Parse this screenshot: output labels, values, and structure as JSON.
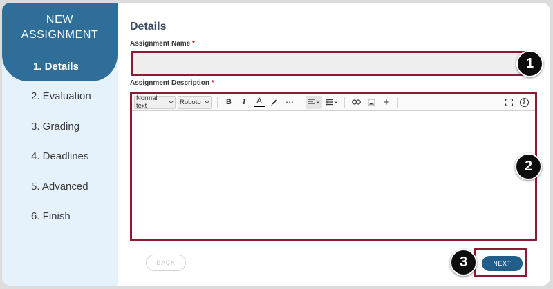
{
  "sidebar": {
    "title_line1": "NEW",
    "title_line2": "ASSIGNMENT",
    "active_step": "1. Details",
    "steps": [
      "2. Evaluation",
      "3. Grading",
      "4. Deadlines",
      "5. Advanced",
      "6. Finish"
    ],
    "header_color": "#2e6e99",
    "background_color": "#e6f2fb"
  },
  "main": {
    "title": "Details",
    "name_label": "Assignment Name",
    "name_value": "",
    "description_label": "Assignment Description",
    "required_marker": "*"
  },
  "editor": {
    "format_select": "Normal text",
    "font_select": "Roboto",
    "tools": [
      "bold-icon",
      "italic-icon",
      "text-color-icon",
      "highlight-icon",
      "more-icon",
      "align-icon",
      "list-icon",
      "link-icon",
      "image-icon",
      "plus-icon",
      "fullscreen-icon",
      "help-icon"
    ],
    "bold_glyph": "B",
    "italic_glyph": "I",
    "color_glyph": "A",
    "more_glyph": "⋯",
    "plus_glyph": "+",
    "help_glyph": "?",
    "content": ""
  },
  "callouts": [
    "1",
    "2",
    "3"
  ],
  "footer": {
    "back_label": "BACK",
    "next_label": "NEXT"
  },
  "colors": {
    "highlight_border": "#8b1a35",
    "next_button": "#235e8a",
    "required": "#c62828"
  }
}
